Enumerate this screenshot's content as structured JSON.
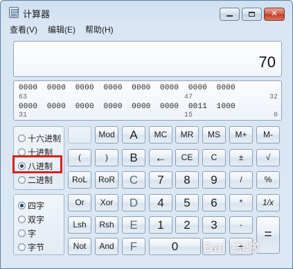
{
  "window": {
    "title": "计算器"
  },
  "menu": {
    "view": "查看(V)",
    "edit": "编辑(E)",
    "help": "帮助(H)"
  },
  "display": {
    "value": "70"
  },
  "binary": {
    "row1": "0000  0000  0000  0000  0000  0000  0000  0000",
    "row1_left": "63",
    "row1_mid": "47",
    "row1_right": "32",
    "row2": "0000  0000  0000  0000  0000  0000  0011  1000",
    "row2_left": "31",
    "row2_mid": "15",
    "row2_right": "0"
  },
  "radix": {
    "hex": "十六进制",
    "dec": "十进制",
    "oct": "八进制",
    "bin": "二进制",
    "selected": "八进制"
  },
  "word": {
    "qword": "四字",
    "dword": "双字",
    "word": "字",
    "byte": "字节",
    "selected": "四字"
  },
  "buttons": {
    "blank": "",
    "mod": "Mod",
    "A": "A",
    "MC": "MC",
    "MR": "MR",
    "MS": "MS",
    "Mplus": "M+",
    "Mminus": "M-",
    "lparen": "(",
    "rparen": ")",
    "B": "B",
    "back": "←",
    "CE": "CE",
    "C": "C",
    "plusminus": "±",
    "sqrt": "√",
    "RoL": "RoL",
    "RoR": "RoR",
    "Cbtn": "C",
    "n7": "7",
    "n8": "8",
    "n9": "9",
    "div": "/",
    "pct": "%",
    "Or": "Or",
    "Xor": "Xor",
    "D": "D",
    "n4": "4",
    "n5": "5",
    "n6": "6",
    "mul": "*",
    "recip": "1/x",
    "Lsh": "Lsh",
    "Rsh": "Rsh",
    "E": "E",
    "n1": "1",
    "n2": "2",
    "n3": "3",
    "sub": "-",
    "eq": "=",
    "Not": "Not",
    "And": "And",
    "F": "F",
    "n0": "0",
    "dot": ".",
    "add": "+"
  },
  "watermark": "Bai 经验"
}
